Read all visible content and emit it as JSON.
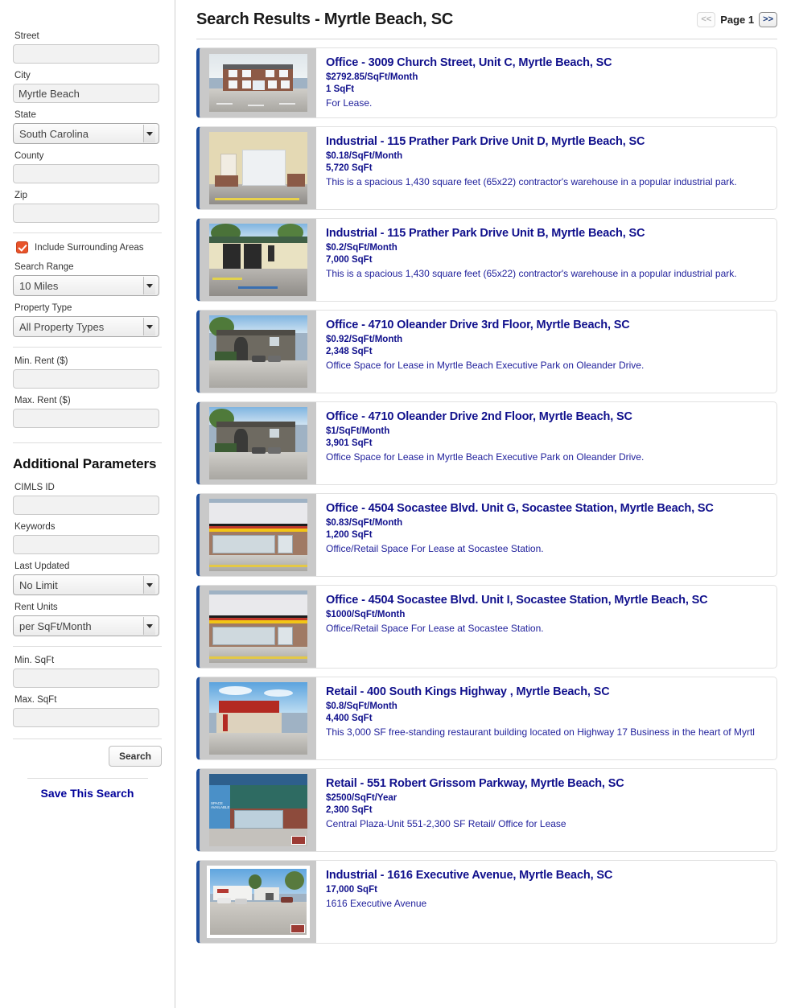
{
  "sidebar": {
    "fields": [
      {
        "label": "Street",
        "type": "text",
        "value": "",
        "placeholder": ""
      },
      {
        "label": "City",
        "type": "text",
        "value": "Myrtle Beach",
        "placeholder": ""
      },
      {
        "label": "State",
        "type": "select",
        "value": "South Carolina"
      },
      {
        "label": "County",
        "type": "text",
        "value": "",
        "placeholder": ""
      },
      {
        "label": "Zip",
        "type": "text",
        "value": "",
        "placeholder": ""
      }
    ],
    "include_surrounding": {
      "label": "Include Surrounding Areas",
      "checked": true,
      "color": "#e8532a"
    },
    "search_range": {
      "label": "Search Range",
      "value": "10 Miles"
    },
    "property_type": {
      "label": "Property Type",
      "value": "All Property Types"
    },
    "min_rent": {
      "label": "Min. Rent ($)",
      "value": ""
    },
    "max_rent": {
      "label": "Max. Rent ($)",
      "value": ""
    },
    "additional_heading": "Additional Parameters",
    "cimls_id": {
      "label": "CIMLS ID",
      "value": ""
    },
    "keywords": {
      "label": "Keywords",
      "value": ""
    },
    "last_updated": {
      "label": "Last Updated",
      "value": "No Limit"
    },
    "rent_units": {
      "label": "Rent Units",
      "value": "per SqFt/Month"
    },
    "min_sqft": {
      "label": "Min. SqFt",
      "value": ""
    },
    "max_sqft": {
      "label": "Max. SqFt",
      "value": ""
    },
    "search_button": "Search",
    "save_search_link": "Save This Search"
  },
  "header": {
    "title": "Search Results - Myrtle Beach, SC",
    "pager": {
      "prev": "<<",
      "label": "Page 1",
      "next": ">>"
    }
  },
  "listings": [
    {
      "title": "Office - 3009 Church Street, Unit C, Myrtle Beach, SC",
      "price": "$2792.85/SqFt/Month",
      "size": "1 SqFt",
      "description": "For Lease.",
      "thumb": "brick-office-building"
    },
    {
      "title": "Industrial - 115 Prather Park Drive Unit D, Myrtle Beach, SC",
      "price": "$0.18/SqFt/Month",
      "size": "5,720 SqFt",
      "description": "This is a spacious 1,430 square feet (65x22) contractor's warehouse in a popular industrial park.",
      "thumb": "tan-garage-unit"
    },
    {
      "title": "Industrial - 115 Prather Park Drive Unit B, Myrtle Beach, SC",
      "price": "$0.2/SqFt/Month",
      "size": "7,000 SqFt",
      "description": "This is a spacious 1,430 square feet (65x22) contractor's warehouse in a popular industrial park.",
      "thumb": "green-roof-warehouse"
    },
    {
      "title": "Office - 4710 Oleander Drive 3rd Floor, Myrtle Beach, SC",
      "price": "$0.92/SqFt/Month",
      "size": "2,348 SqFt",
      "description": "Office Space for Lease in Myrtle Beach Executive Park on Oleander Drive.",
      "thumb": "gray-office-park"
    },
    {
      "title": "Office - 4710 Oleander Drive 2nd Floor, Myrtle Beach, SC",
      "price": "$1/SqFt/Month",
      "size": "3,901 SqFt",
      "description": "Office Space for Lease in Myrtle Beach Executive Park on Oleander Drive.",
      "thumb": "gray-office-park"
    },
    {
      "title": "Office - 4504 Socastee Blvd. Unit G, Socastee Station, Myrtle Beach, SC",
      "price": "$0.83/SqFt/Month",
      "size": "1,200 SqFt",
      "description": "Office/Retail Space For Lease at Socastee Station.",
      "thumb": "yellow-awning-storefront"
    },
    {
      "title": "Office - 4504 Socastee Blvd. Unit I, Socastee Station, Myrtle Beach, SC",
      "price": "$1000/SqFt/Month",
      "size": "",
      "description": "Office/Retail Space For Lease at Socastee Station.",
      "thumb": "yellow-awning-storefront"
    },
    {
      "title": "Retail - 400 South Kings Highway , Myrtle Beach, SC",
      "price": "$0.8/SqFt/Month",
      "size": "4,400 SqFt",
      "description": "This 3,000 SF free-standing restaurant building located on Highway 17 Business in the heart of Myrtl",
      "thumb": "red-roof-restaurant"
    },
    {
      "title": "Retail - 551 Robert Grissom Parkway, Myrtle Beach, SC",
      "price": "$2500/SqFt/Year",
      "size": "2,300 SqFt",
      "description": "Central Plaza-Unit 551-2,300 SF Retail/ Office for Lease",
      "thumb": "space-available-plaza"
    },
    {
      "title": "Industrial - 1616 Executive Avenue, Myrtle Beach, SC",
      "price": "",
      "size": "17,000 SqFt",
      "description": "1616 Executive Avenue",
      "thumb": "white-industrial-lot"
    }
  ]
}
